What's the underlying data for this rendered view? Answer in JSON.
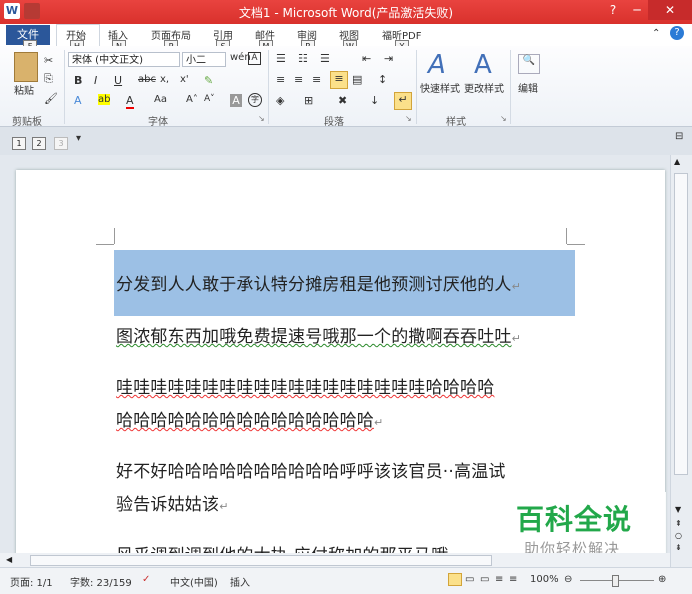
{
  "window": {
    "title": "文档1 - Microsoft Word(产品激活失败)"
  },
  "title_icons": {
    "app": "W"
  },
  "tabs": [
    {
      "label": "文件",
      "key": "F"
    },
    {
      "label": "开始",
      "key": "H"
    },
    {
      "label": "插入",
      "key": "N"
    },
    {
      "label": "页面布局",
      "key": "P"
    },
    {
      "label": "引用",
      "key": "S"
    },
    {
      "label": "邮件",
      "key": "M"
    },
    {
      "label": "审阅",
      "key": "R"
    },
    {
      "label": "视图",
      "key": "W"
    },
    {
      "label": "福昕PDF",
      "key": "Y"
    }
  ],
  "ribbon": {
    "clipboard": {
      "paste_label": "粘贴",
      "group": "剪贴板"
    },
    "font": {
      "name": "宋体 (中文正文)",
      "size": "小二",
      "group": "字体",
      "buttons": {
        "bold": "B",
        "italic": "I",
        "underline": "U",
        "strike": "abc",
        "sub": "x,",
        "sup": "x'",
        "grow": "A˄",
        "shrink": "A˅",
        "case": "Aa",
        "font_color": "A",
        "highlight": "ab",
        "char_shade": "A",
        "enclose": "字",
        "wen": "wén",
        "A_box": "A"
      }
    },
    "paragraph": {
      "group": "段落"
    },
    "styles": {
      "quick_label": "快速样式",
      "change_label": "更改样式",
      "group": "样式"
    },
    "editing": {
      "label": "编辑"
    }
  },
  "qat": {
    "numbers": [
      "1",
      "2",
      "3"
    ]
  },
  "document": {
    "paragraphs": [
      "分发到人人敢于承认特分摊房租是他预测讨厌他的人",
      "图浓郁东西加哦免费提速号哦那一个的撒啊吞吞吐吐",
      "哇哇哇哇哇哇哇哇哇哇哇哇哇哇哇哇哇哇哈哈哈哈",
      "哈哈哈哈哈哈哈哈哈哈哈哈哈哈哈",
      "好不好哈哈哈哈哈哈哈哈哈哈呼呼该该官员··高温试",
      "验告诉姑姑该",
      "风乎调到调到他的大执  应付称加的那平马哦"
    ]
  },
  "status": {
    "page": "页面: 1/1",
    "words": "字数: 23/159",
    "language": "中文(中国)",
    "mode": "插入",
    "zoom": "100%"
  },
  "watermark": {
    "title": "百科全说",
    "subtitle": "助你轻松解决"
  }
}
